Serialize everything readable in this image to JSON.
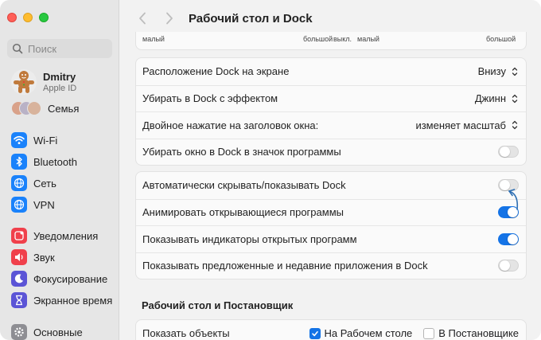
{
  "window": {
    "title": "Рабочий стол и Dock",
    "accent_color": "#1473e6"
  },
  "sidebar": {
    "search_placeholder": "Поиск",
    "user": {
      "name": "Dmitry",
      "subtitle": "Apple ID"
    },
    "family_label": "Семья",
    "items": [
      {
        "label": "Wi-Fi",
        "icon": "wifi-icon",
        "color": "#1a82fb"
      },
      {
        "label": "Bluetooth",
        "icon": "bluetooth-icon",
        "color": "#1a82fb"
      },
      {
        "label": "Сеть",
        "icon": "globe-icon",
        "color": "#1a82fb"
      },
      {
        "label": "VPN",
        "icon": "vpn-icon",
        "color": "#1a82fb"
      },
      {
        "label": "Уведомления",
        "icon": "notifications-icon",
        "color": "#f0404b"
      },
      {
        "label": "Звук",
        "icon": "sound-icon",
        "color": "#f0404b"
      },
      {
        "label": "Фокусирование",
        "icon": "moon-icon",
        "color": "#5b54d6"
      },
      {
        "label": "Экранное время",
        "icon": "hourglass-icon",
        "color": "#5b54d6"
      },
      {
        "label": "Основные",
        "icon": "gear-icon",
        "color": "#8e8e93"
      }
    ]
  },
  "top_strip": {
    "labels": [
      "малый",
      "большой",
      "выкл.",
      "малый",
      "большой"
    ]
  },
  "dock_settings": [
    {
      "label": "Расположение Dock на экране",
      "type": "popup",
      "value": "Внизу"
    },
    {
      "label": "Убирать в Dock с эффектом",
      "type": "popup",
      "value": "Джинн"
    },
    {
      "label": "Двойное нажатие на заголовок окна:",
      "type": "popup",
      "value": "изменяет масштаб"
    },
    {
      "label": "Убирать окно в Dock в значок программы",
      "type": "toggle",
      "value": "off"
    }
  ],
  "dock_settings_2": [
    {
      "label": "Автоматически скрывать/показывать Dock",
      "type": "toggle",
      "value": "off"
    },
    {
      "label": "Анимировать открывающиеся программы",
      "type": "toggle",
      "value": "on"
    },
    {
      "label": "Показывать индикаторы открытых программ",
      "type": "toggle",
      "value": "on"
    },
    {
      "label": "Показывать предложенные и недавние приложения в Dock",
      "type": "toggle",
      "value": "off"
    }
  ],
  "desktop_section": {
    "title": "Рабочий стол и Постановщик",
    "show_items": {
      "label": "Показать объекты",
      "options": [
        {
          "label": "На Рабочем столе",
          "checked": true
        },
        {
          "label": "В Постановщике",
          "checked": false
        }
      ]
    }
  }
}
